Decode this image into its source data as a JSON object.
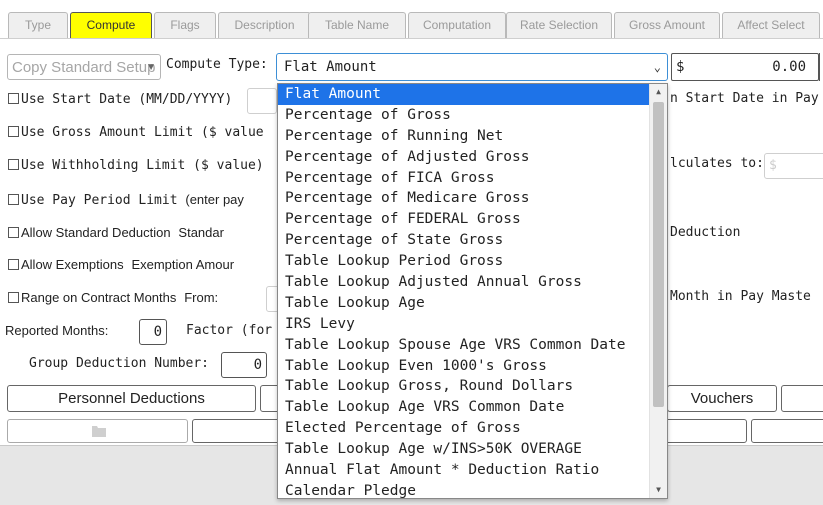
{
  "tabs": [
    "Type",
    "Compute",
    "Flags",
    "Description",
    "Table Name",
    "Computation",
    "Rate Selection",
    "Gross Amount",
    "Affect Select"
  ],
  "copy_select": "Copy Standard Setup",
  "compute_type_label": "Compute Type:",
  "compute_type_value": "Flat Amount",
  "amount": {
    "currency": "$",
    "value": "0.00"
  },
  "rows": {
    "start_date": "Use Start Date (MM/DD/YYYY)",
    "gross_limit": "Use Gross Amount Limit ($ value",
    "withholding_limit": "Use Withholding Limit ($ value)",
    "pay_period_limit": "Use Pay Period Limit",
    "pay_period_hint": "(enter pay",
    "standard_deduction": "Allow Standard Deduction",
    "standard_hint": "Standar",
    "exemptions": "Allow Exemptions",
    "exemption_hint": "Exemption Amour",
    "range_months": "Range on Contract Months",
    "from_label": "From:"
  },
  "right_fragments": {
    "start_date_pay": "n Start Date in Pay",
    "calculates_to": "lculates to:",
    "calc_placeholder": "$",
    "deduction": "Deduction",
    "month_pay_master": "Month in Pay Maste"
  },
  "reported_months": {
    "label": "Reported Months:",
    "value": "0",
    "factor": "Factor (for"
  },
  "group_deduction": {
    "label": "Group Deduction Number:",
    "value": "0"
  },
  "buttons": {
    "personnel": "Personnel Deductions",
    "vouchers": "Vouchers"
  },
  "dropdown_options": [
    "Flat Amount",
    "Percentage of Gross",
    "Percentage of Running Net",
    "Percentage of Adjusted Gross",
    "Percentage of FICA Gross",
    "Percentage of Medicare Gross",
    "Percentage of FEDERAL Gross",
    "Percentage of State Gross",
    "Table Lookup Period Gross",
    "Table Lookup Adjusted Annual Gross",
    "Table Lookup Age",
    "IRS Levy",
    "Table Lookup Spouse Age VRS Common Date",
    "Table Lookup Even 1000's Gross",
    "Table Lookup Gross, Round Dollars",
    "Table Lookup Age VRS Common Date",
    "Elected Percentage of Gross",
    "Table Lookup Age w/INS>50K OVERAGE",
    "Annual Flat Amount * Deduction Ratio",
    "Calendar Pledge"
  ],
  "selected_index": 0,
  "colors": {
    "active_tab": "#ffff00",
    "selection": "#1e73e8",
    "focus_border": "#3d8fd6"
  },
  "icons": [
    "folder-icon",
    "chevron-down-icon",
    "scroll-up-icon",
    "scroll-down-icon"
  ]
}
